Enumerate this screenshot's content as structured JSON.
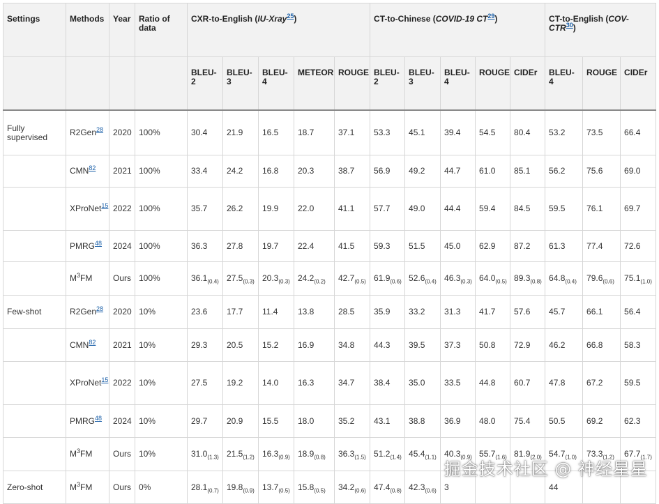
{
  "headers": {
    "settings": "Settings",
    "methods": "Methods",
    "year": "Year",
    "ratio": "Ratio of data",
    "group1": {
      "prefix": "CXR-to-English (",
      "dataset": "IU-Xray",
      "ref": "25",
      "suffix": ")"
    },
    "group2": {
      "prefix": "CT-to-Chinese (",
      "dataset": "COVID-19 CT",
      "ref": "29",
      "suffix": ")"
    },
    "group3": {
      "prefix": "CT-to-English (",
      "dataset": "COV-CTR",
      "ref": "30",
      "suffix": ")"
    },
    "metrics1": [
      "BLEU-2",
      "BLEU-3",
      "BLEU-4",
      "METEOR",
      "ROUGE"
    ],
    "metrics2": [
      "BLEU-2",
      "BLEU-3",
      "BLEU-4",
      "ROUGE",
      "CIDEr"
    ],
    "metrics3": [
      "BLEU-4",
      "ROUGE",
      "CIDEr"
    ]
  },
  "rows": [
    {
      "setting": "Fully supervised",
      "method": "R2Gen",
      "ref": "28",
      "year": "2020",
      "ratio": "100%",
      "v": [
        [
          "30.4",
          ""
        ],
        [
          "21.9",
          ""
        ],
        [
          "16.5",
          ""
        ],
        [
          "18.7",
          ""
        ],
        [
          "37.1",
          ""
        ],
        [
          "53.3",
          ""
        ],
        [
          "45.1",
          ""
        ],
        [
          "39.4",
          ""
        ],
        [
          "54.5",
          ""
        ],
        [
          "80.4",
          ""
        ],
        [
          "53.2",
          ""
        ],
        [
          "73.5",
          ""
        ],
        [
          "66.4",
          ""
        ]
      ]
    },
    {
      "setting": "",
      "method": "CMN",
      "ref": "82",
      "year": "2021",
      "ratio": "100%",
      "v": [
        [
          "33.4",
          ""
        ],
        [
          "24.2",
          ""
        ],
        [
          "16.8",
          ""
        ],
        [
          "20.3",
          ""
        ],
        [
          "38.7",
          ""
        ],
        [
          "56.9",
          ""
        ],
        [
          "49.2",
          ""
        ],
        [
          "44.7",
          ""
        ],
        [
          "61.0",
          ""
        ],
        [
          "85.1",
          ""
        ],
        [
          "56.2",
          ""
        ],
        [
          "75.6",
          ""
        ],
        [
          "69.0",
          ""
        ]
      ]
    },
    {
      "setting": "",
      "method": "XProNet",
      "ref": "15",
      "year": "2022",
      "ratio": "100%",
      "v": [
        [
          "35.7",
          ""
        ],
        [
          "26.2",
          ""
        ],
        [
          "19.9",
          ""
        ],
        [
          "22.0",
          ""
        ],
        [
          "41.1",
          ""
        ],
        [
          "57.7",
          ""
        ],
        [
          "49.0",
          ""
        ],
        [
          "44.4",
          ""
        ],
        [
          "59.4",
          ""
        ],
        [
          "84.5",
          ""
        ],
        [
          "59.5",
          ""
        ],
        [
          "76.1",
          ""
        ],
        [
          "69.7",
          ""
        ]
      ]
    },
    {
      "setting": "",
      "method": "PMRG",
      "ref": "48",
      "year": "2024",
      "ratio": "100%",
      "v": [
        [
          "36.3",
          ""
        ],
        [
          "27.8",
          ""
        ],
        [
          "19.7",
          ""
        ],
        [
          "22.4",
          ""
        ],
        [
          "41.5",
          ""
        ],
        [
          "59.3",
          ""
        ],
        [
          "51.5",
          ""
        ],
        [
          "45.0",
          ""
        ],
        [
          "62.9",
          ""
        ],
        [
          "87.2",
          ""
        ],
        [
          "61.3",
          ""
        ],
        [
          "77.4",
          ""
        ],
        [
          "72.6",
          ""
        ]
      ]
    },
    {
      "setting": "",
      "method": "M",
      "sup": "3",
      "method_tail": "FM",
      "ref": "",
      "year": "Ours",
      "ratio": "100%",
      "v": [
        [
          "36.1",
          "(0.4)"
        ],
        [
          "27.5",
          "(0.3)"
        ],
        [
          "20.3",
          "(0.3)"
        ],
        [
          "24.2",
          "(0.2)"
        ],
        [
          "42.7",
          "(0.5)"
        ],
        [
          "61.9",
          "(0.6)"
        ],
        [
          "52.6",
          "(0.4)"
        ],
        [
          "46.3",
          "(0.3)"
        ],
        [
          "64.0",
          "(0.5)"
        ],
        [
          "89.3",
          "(0.8)"
        ],
        [
          "64.8",
          "(0.4)"
        ],
        [
          "79.6",
          "(0.6)"
        ],
        [
          "75.1",
          "(1.0)"
        ]
      ]
    },
    {
      "setting": "Few-shot",
      "method": "R2Gen",
      "ref": "28",
      "year": "2020",
      "ratio": "10%",
      "v": [
        [
          "23.6",
          ""
        ],
        [
          "17.7",
          ""
        ],
        [
          "11.4",
          ""
        ],
        [
          "13.8",
          ""
        ],
        [
          "28.5",
          ""
        ],
        [
          "35.9",
          ""
        ],
        [
          "33.2",
          ""
        ],
        [
          "31.3",
          ""
        ],
        [
          "41.7",
          ""
        ],
        [
          "57.6",
          ""
        ],
        [
          "45.7",
          ""
        ],
        [
          "66.1",
          ""
        ],
        [
          "56.4",
          ""
        ]
      ]
    },
    {
      "setting": "",
      "method": "CMN",
      "ref": "82",
      "year": "2021",
      "ratio": "10%",
      "v": [
        [
          "29.3",
          ""
        ],
        [
          "20.5",
          ""
        ],
        [
          "15.2",
          ""
        ],
        [
          "16.9",
          ""
        ],
        [
          "34.8",
          ""
        ],
        [
          "44.3",
          ""
        ],
        [
          "39.5",
          ""
        ],
        [
          "37.3",
          ""
        ],
        [
          "50.8",
          ""
        ],
        [
          "72.9",
          ""
        ],
        [
          "46.2",
          ""
        ],
        [
          "66.8",
          ""
        ],
        [
          "58.3",
          ""
        ]
      ]
    },
    {
      "setting": "",
      "method": "XProNet",
      "ref": "15",
      "year": "2022",
      "ratio": "10%",
      "v": [
        [
          "27.5",
          ""
        ],
        [
          "19.2",
          ""
        ],
        [
          "14.0",
          ""
        ],
        [
          "16.3",
          ""
        ],
        [
          "34.7",
          ""
        ],
        [
          "38.4",
          ""
        ],
        [
          "35.0",
          ""
        ],
        [
          "33.5",
          ""
        ],
        [
          "44.8",
          ""
        ],
        [
          "60.7",
          ""
        ],
        [
          "47.8",
          ""
        ],
        [
          "67.2",
          ""
        ],
        [
          "59.5",
          ""
        ]
      ]
    },
    {
      "setting": "",
      "method": "PMRG",
      "ref": "48",
      "year": "2024",
      "ratio": "10%",
      "v": [
        [
          "29.7",
          ""
        ],
        [
          "20.9",
          ""
        ],
        [
          "15.5",
          ""
        ],
        [
          "18.0",
          ""
        ],
        [
          "35.2",
          ""
        ],
        [
          "43.1",
          ""
        ],
        [
          "38.8",
          ""
        ],
        [
          "36.9",
          ""
        ],
        [
          "48.0",
          ""
        ],
        [
          "75.4",
          ""
        ],
        [
          "50.5",
          ""
        ],
        [
          "69.2",
          ""
        ],
        [
          "62.3",
          ""
        ]
      ]
    },
    {
      "setting": "",
      "method": "M",
      "sup": "3",
      "method_tail": "FM",
      "ref": "",
      "year": "Ours",
      "ratio": "10%",
      "v": [
        [
          "31.0",
          "(1.3)"
        ],
        [
          "21.5",
          "(1.2)"
        ],
        [
          "16.3",
          "(0.9)"
        ],
        [
          "18.9",
          "(0.8)"
        ],
        [
          "36.3",
          "(1.5)"
        ],
        [
          "51.2",
          "(1.4)"
        ],
        [
          "45.4",
          "(1.1)"
        ],
        [
          "40.3",
          "(0.9)"
        ],
        [
          "55.7",
          "(1.6)"
        ],
        [
          "81.9",
          "(2.0)"
        ],
        [
          "54.7",
          "(1.0)"
        ],
        [
          "73.3",
          "(1.2)"
        ],
        [
          "67.7",
          "(1.7)"
        ]
      ]
    },
    {
      "setting": "Zero-shot",
      "method": "M",
      "sup": "3",
      "method_tail": "FM",
      "ref": "",
      "year": "Ours",
      "ratio": "0%",
      "v": [
        [
          "28.1",
          "(0.7)"
        ],
        [
          "19.8",
          "(0.9)"
        ],
        [
          "13.7",
          "(0.5)"
        ],
        [
          "15.8",
          "(0.5)"
        ],
        [
          "34.2",
          "(0.6)"
        ],
        [
          "47.4",
          "(0.8)"
        ],
        [
          "42.3",
          "(0.6)"
        ],
        [
          "3",
          ""
        ],
        [
          "",
          ""
        ],
        [
          "",
          ""
        ],
        [
          "44",
          ""
        ],
        [
          "",
          ""
        ],
        [
          "",
          ""
        ]
      ]
    }
  ],
  "watermark": "掘金技术社区 @ 神经星星"
}
